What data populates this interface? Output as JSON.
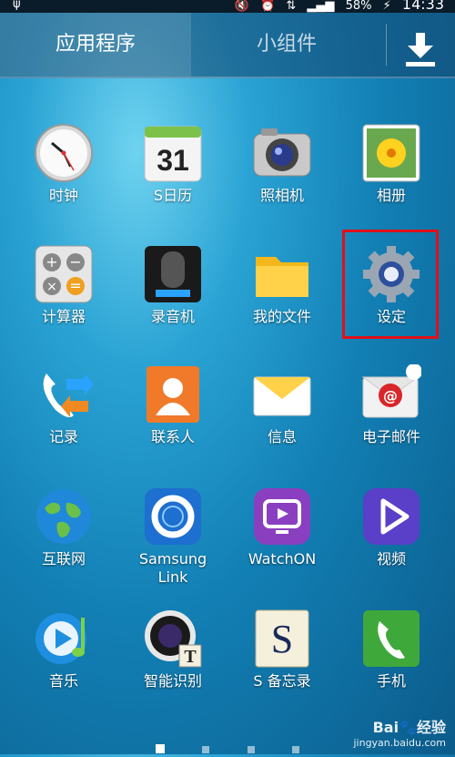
{
  "status": {
    "battery": "58%",
    "time": "14:33"
  },
  "tabs": {
    "apps": "应用程序",
    "widgets": "小组件"
  },
  "apps": [
    {
      "label": "时钟"
    },
    {
      "label": "S日历"
    },
    {
      "label": "照相机"
    },
    {
      "label": "相册"
    },
    {
      "label": "计算器"
    },
    {
      "label": "录音机"
    },
    {
      "label": "我的文件"
    },
    {
      "label": "设定"
    },
    {
      "label": "记录"
    },
    {
      "label": "联系人"
    },
    {
      "label": "信息"
    },
    {
      "label": "电子邮件"
    },
    {
      "label": "互联网"
    },
    {
      "label": "Samsung Link"
    },
    {
      "label": "WatchON"
    },
    {
      "label": "视频"
    },
    {
      "label": "音乐"
    },
    {
      "label": "智能识别"
    },
    {
      "label": "S 备忘录"
    },
    {
      "label": "手机"
    }
  ],
  "calendar_day": "31",
  "watermark": {
    "line1": "Bai🐾经验",
    "line2": "jingyan.baidu.com"
  }
}
